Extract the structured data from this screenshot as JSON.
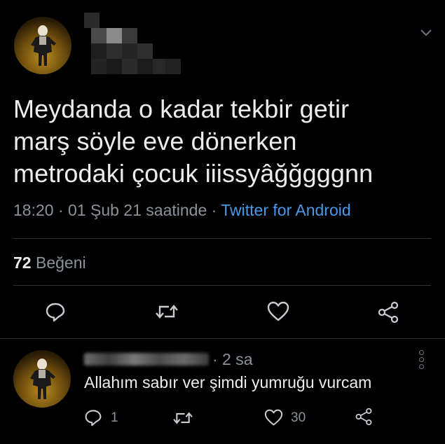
{
  "tweet": {
    "text_lines": [
      "Meydanda o kadar tekbir  getir",
      "marş söyle eve dönerken",
      "metrodaki çocuk iiissyâğğgggnn"
    ],
    "time": "18:20",
    "date": "01 Şub 21 saatinde",
    "separator": "·",
    "source": "Twitter for Android",
    "like_count": "72",
    "like_label": "Beğeni"
  },
  "reply": {
    "time": "· 2 sa",
    "text": "Allahım sabır  ver şimdi yumruğu vurcam",
    "reply_count": "1",
    "like_count": "30"
  },
  "icons": {
    "chevron": "chevron-down-icon",
    "reply": "reply-icon",
    "retweet": "retweet-icon",
    "like": "heart-icon",
    "share": "share-icon",
    "more": "more-vertical-icon"
  },
  "colors": {
    "background": "#000000",
    "text": "#ececec",
    "muted": "#8b9299",
    "link": "#4a99e9",
    "divider": "#2f3336"
  }
}
